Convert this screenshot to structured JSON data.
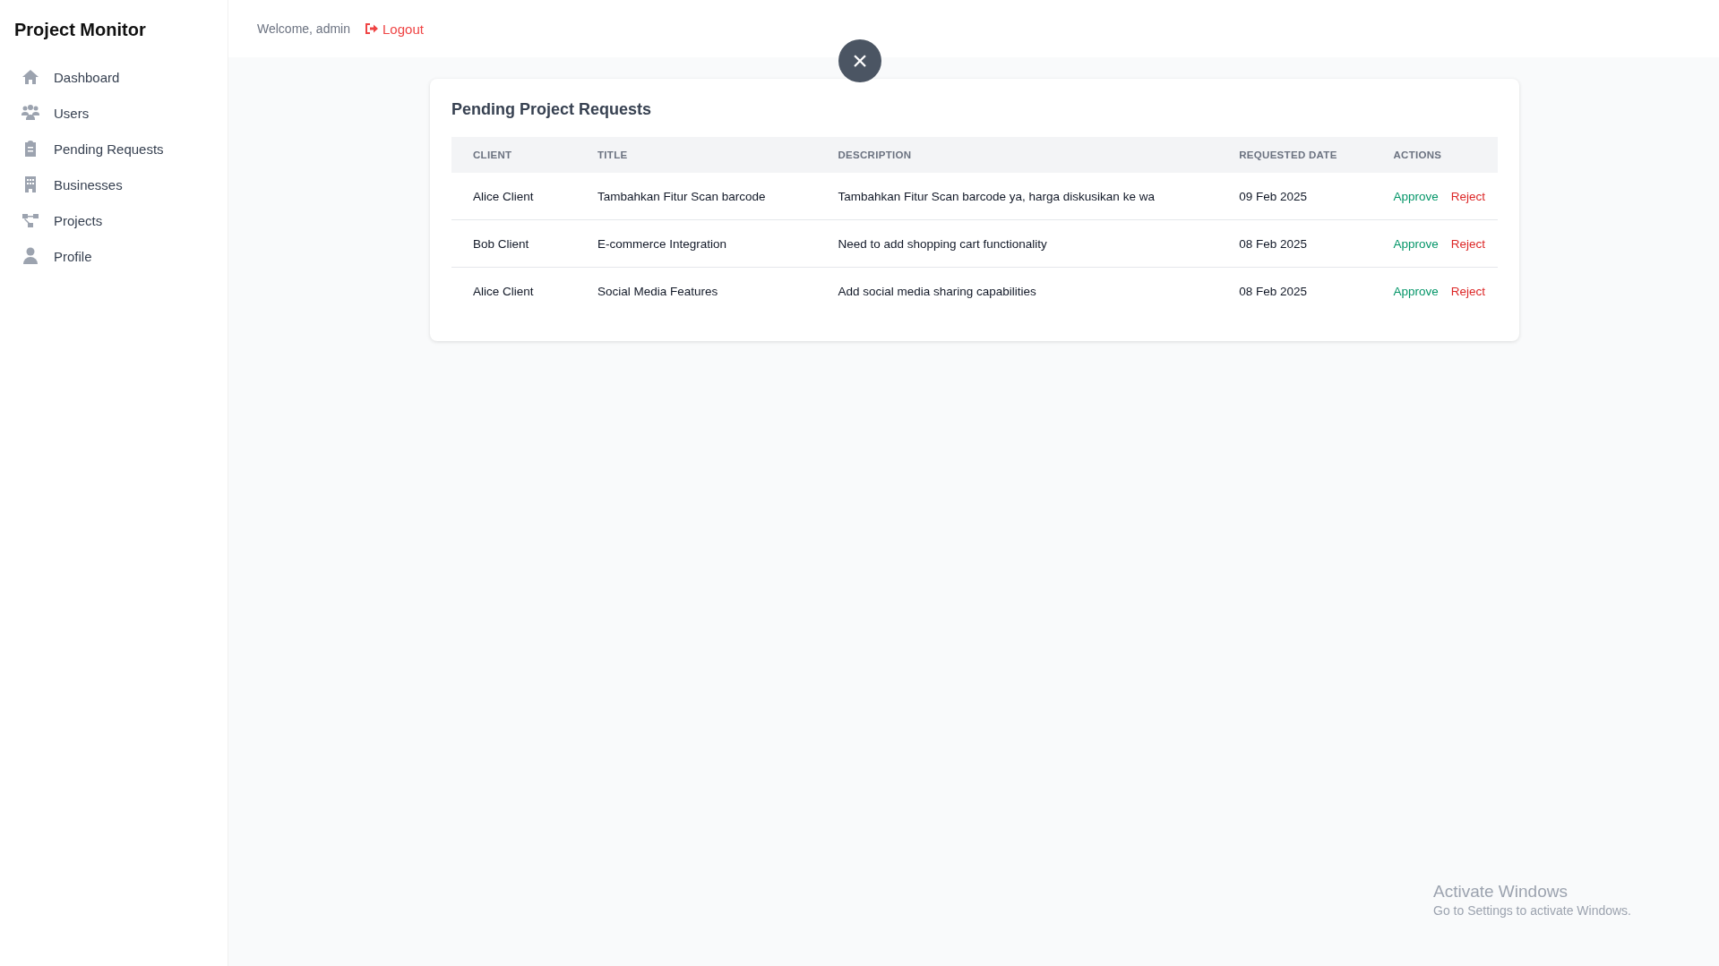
{
  "sidebar": {
    "title": "Project Monitor",
    "items": [
      {
        "label": "Dashboard"
      },
      {
        "label": "Users"
      },
      {
        "label": "Pending Requests"
      },
      {
        "label": "Businesses"
      },
      {
        "label": "Projects"
      },
      {
        "label": "Profile"
      }
    ]
  },
  "header": {
    "welcome": "Welcome, admin",
    "logout": "Logout"
  },
  "close_button": "×",
  "card": {
    "title": "Pending Project Requests",
    "table": {
      "columns": [
        "CLIENT",
        "TITLE",
        "DESCRIPTION",
        "REQUESTED DATE",
        "ACTIONS"
      ],
      "rows": [
        {
          "client": "Alice Client",
          "title": "Tambahkan Fitur Scan barcode",
          "description": "Tambahkan Fitur Scan barcode ya, harga diskusikan ke wa",
          "date": "09 Feb 2025",
          "approve": "Approve",
          "reject": "Reject"
        },
        {
          "client": "Bob Client",
          "title": "E-commerce Integration",
          "description": "Need to add shopping cart functionality",
          "date": "08 Feb 2025",
          "approve": "Approve",
          "reject": "Reject"
        },
        {
          "client": "Alice Client",
          "title": "Social Media Features",
          "description": "Add social media sharing capabilities",
          "date": "08 Feb 2025",
          "approve": "Approve",
          "reject": "Reject"
        }
      ]
    }
  },
  "os_notice": {
    "title": "Activate Windows",
    "subtitle": "Go to Settings to activate Windows."
  }
}
